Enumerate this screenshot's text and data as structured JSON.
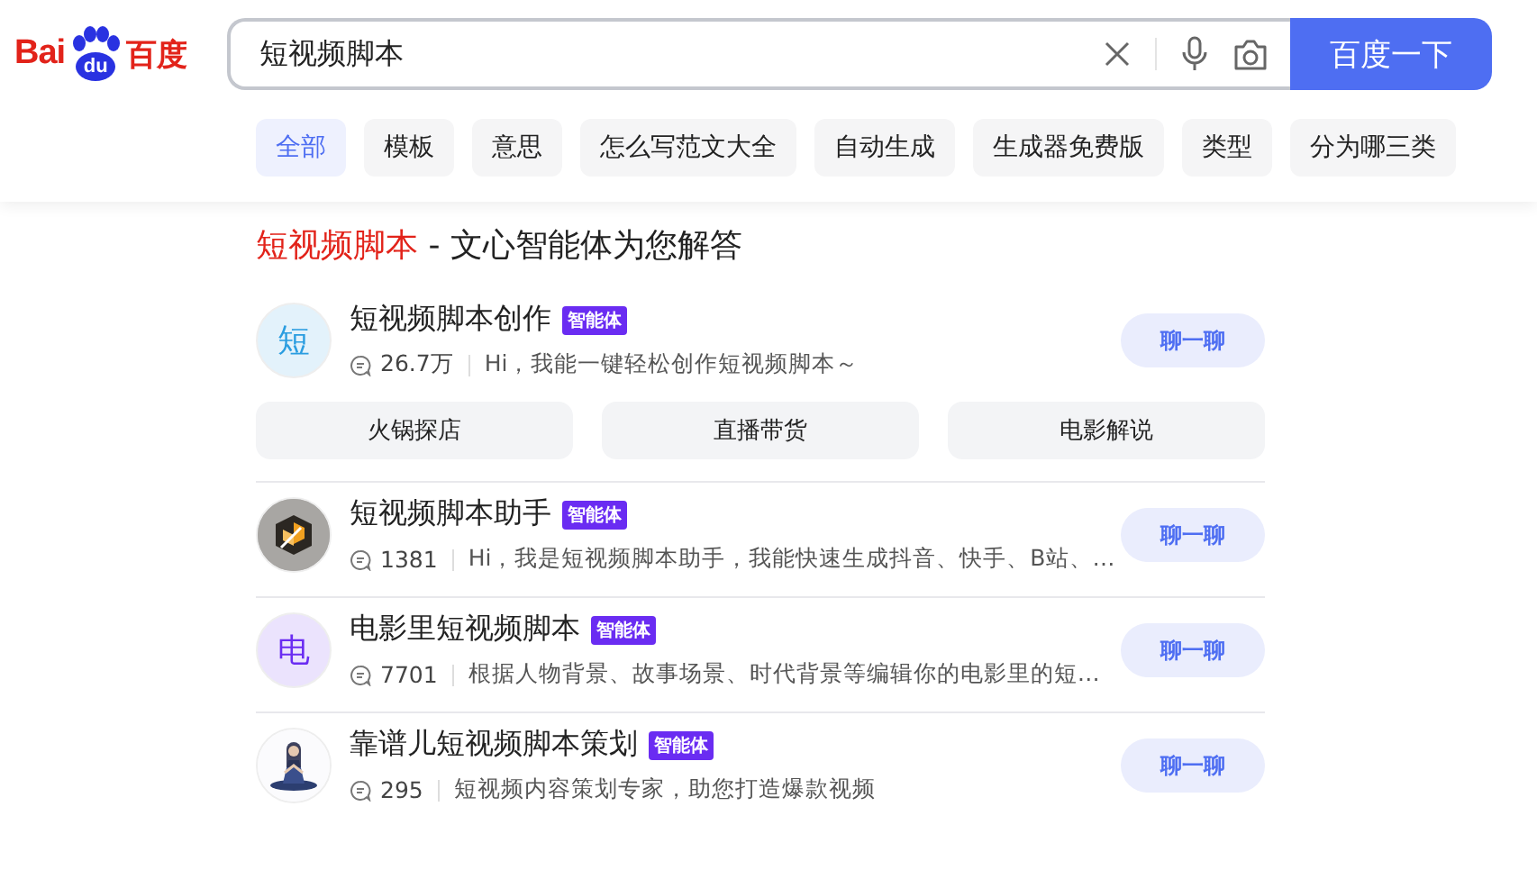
{
  "logo": {
    "left": "Bai",
    "paw": "du",
    "right": "百度"
  },
  "search": {
    "value": "短视频脚本",
    "button": "百度一下"
  },
  "tabs": [
    {
      "label": "全部",
      "selected": true
    },
    {
      "label": "模板",
      "selected": false
    },
    {
      "label": "意思",
      "selected": false
    },
    {
      "label": "怎么写范文大全",
      "selected": false
    },
    {
      "label": "自动生成",
      "selected": false
    },
    {
      "label": "生成器免费版",
      "selected": false
    },
    {
      "label": "类型",
      "selected": false
    },
    {
      "label": "分为哪三类",
      "selected": false
    }
  ],
  "result": {
    "title_query": "短视频脚本",
    "title_rest": " - 文心智能体为您解答",
    "agents": [
      {
        "kind": "letter",
        "avatar_text": "短",
        "color": "#2a9de0",
        "name": "短视频脚本创作",
        "badge": "智能体",
        "count": "26.7万",
        "description": "Hi，我能一键轻松创作短视频脚本～",
        "button": "聊一聊",
        "suggestions": [
          "火锅探店",
          "直播带货",
          "电影解说"
        ]
      },
      {
        "kind": "cube",
        "name": "短视频脚本助手",
        "badge": "智能体",
        "count": "1381",
        "description": "Hi，我是短视频脚本助手，我能快速生成抖音、快手、B站、…",
        "button": "聊一聊"
      },
      {
        "kind": "letter",
        "avatar_text": "电",
        "color": "#6a2cf2",
        "name": "电影里短视频脚本",
        "badge": "智能体",
        "count": "7701",
        "description": "根据人物背景、故事场景、时代背景等编辑你的电影里的短…",
        "button": "聊一聊"
      },
      {
        "kind": "figure",
        "name": "靠谱儿短视频脚本策划",
        "badge": "智能体",
        "count": "295",
        "description": "短视频内容策划专家，助您打造爆款视频",
        "button": "聊一聊"
      }
    ]
  }
}
